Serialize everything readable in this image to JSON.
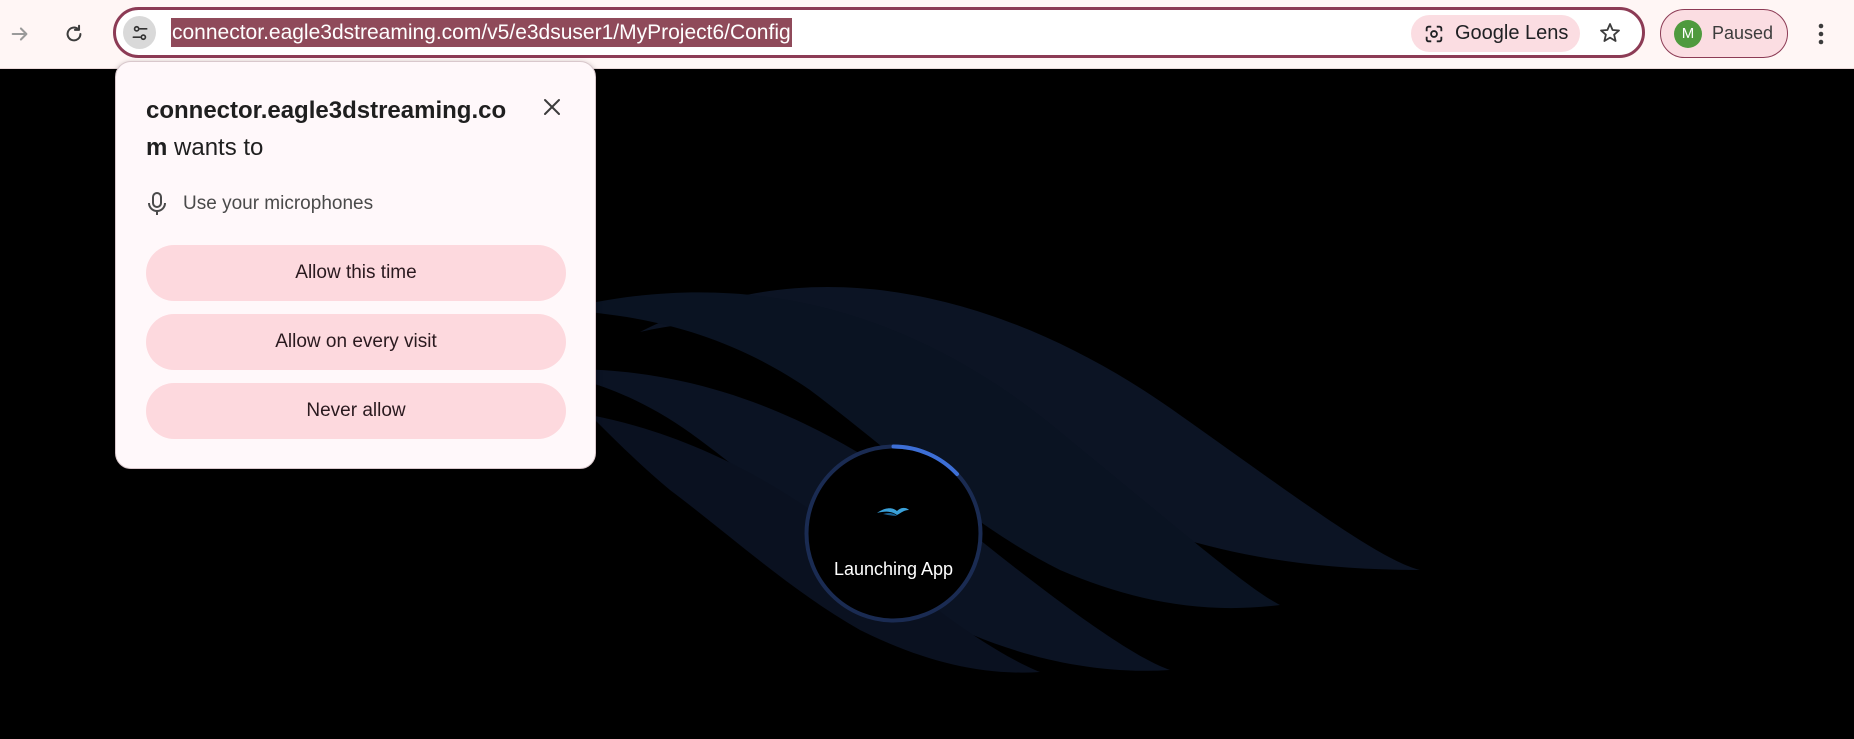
{
  "browser": {
    "url": "connector.eagle3dstreaming.com/v5/e3dsuser1/MyProject6/Config",
    "lens_label": "Google Lens",
    "profile": {
      "initial": "M",
      "status": "Paused",
      "avatar_color": "#4f9a3e"
    },
    "icons": {
      "forward": "arrow-forward-icon",
      "reload": "reload-icon",
      "site_info": "tune-icon",
      "lens": "google-lens-icon",
      "bookmark": "star-icon",
      "menu": "kebab-menu-icon"
    },
    "accent_color": "#8c3b55"
  },
  "permission_prompt": {
    "origin": "connector.eagle3dstreaming.com",
    "suffix": " wants to",
    "permission_label": "Use your microphones",
    "permission_icon": "microphone-icon",
    "buttons": {
      "allow_once": "Allow this time",
      "allow_always": "Allow on every visit",
      "never": "Never allow"
    },
    "button_color": "#fdd9de"
  },
  "page": {
    "loading_label": "Launching App",
    "background_color": "#000000",
    "wave_color": "#0b1220",
    "progress_arc_color": "#3d6fd6"
  }
}
